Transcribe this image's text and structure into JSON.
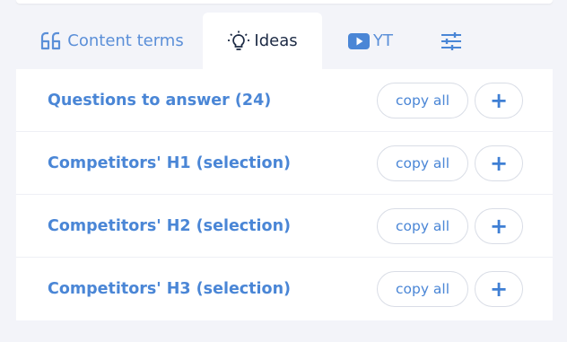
{
  "tabs": [
    {
      "label": "Content terms",
      "icon": "quote-icon",
      "active": false
    },
    {
      "label": "Ideas",
      "icon": "lightbulb-icon",
      "active": true
    },
    {
      "label": "YT",
      "icon": "youtube-icon",
      "active": false
    },
    {
      "label": "",
      "icon": "sliders-icon",
      "active": false
    }
  ],
  "rows": [
    {
      "title": "Questions to answer (24)",
      "copy_label": "copy all",
      "add_label": "+"
    },
    {
      "title": "Competitors' H1 (selection)",
      "copy_label": "copy all",
      "add_label": "+"
    },
    {
      "title": "Competitors' H2 (selection)",
      "copy_label": "copy all",
      "add_label": "+"
    },
    {
      "title": "Competitors' H3 (selection)",
      "copy_label": "copy all",
      "add_label": "+"
    }
  ],
  "colors": {
    "accent": "#4a86d6",
    "active_text": "#1c2a44",
    "background": "#f3f4f9",
    "panel": "#ffffff"
  }
}
